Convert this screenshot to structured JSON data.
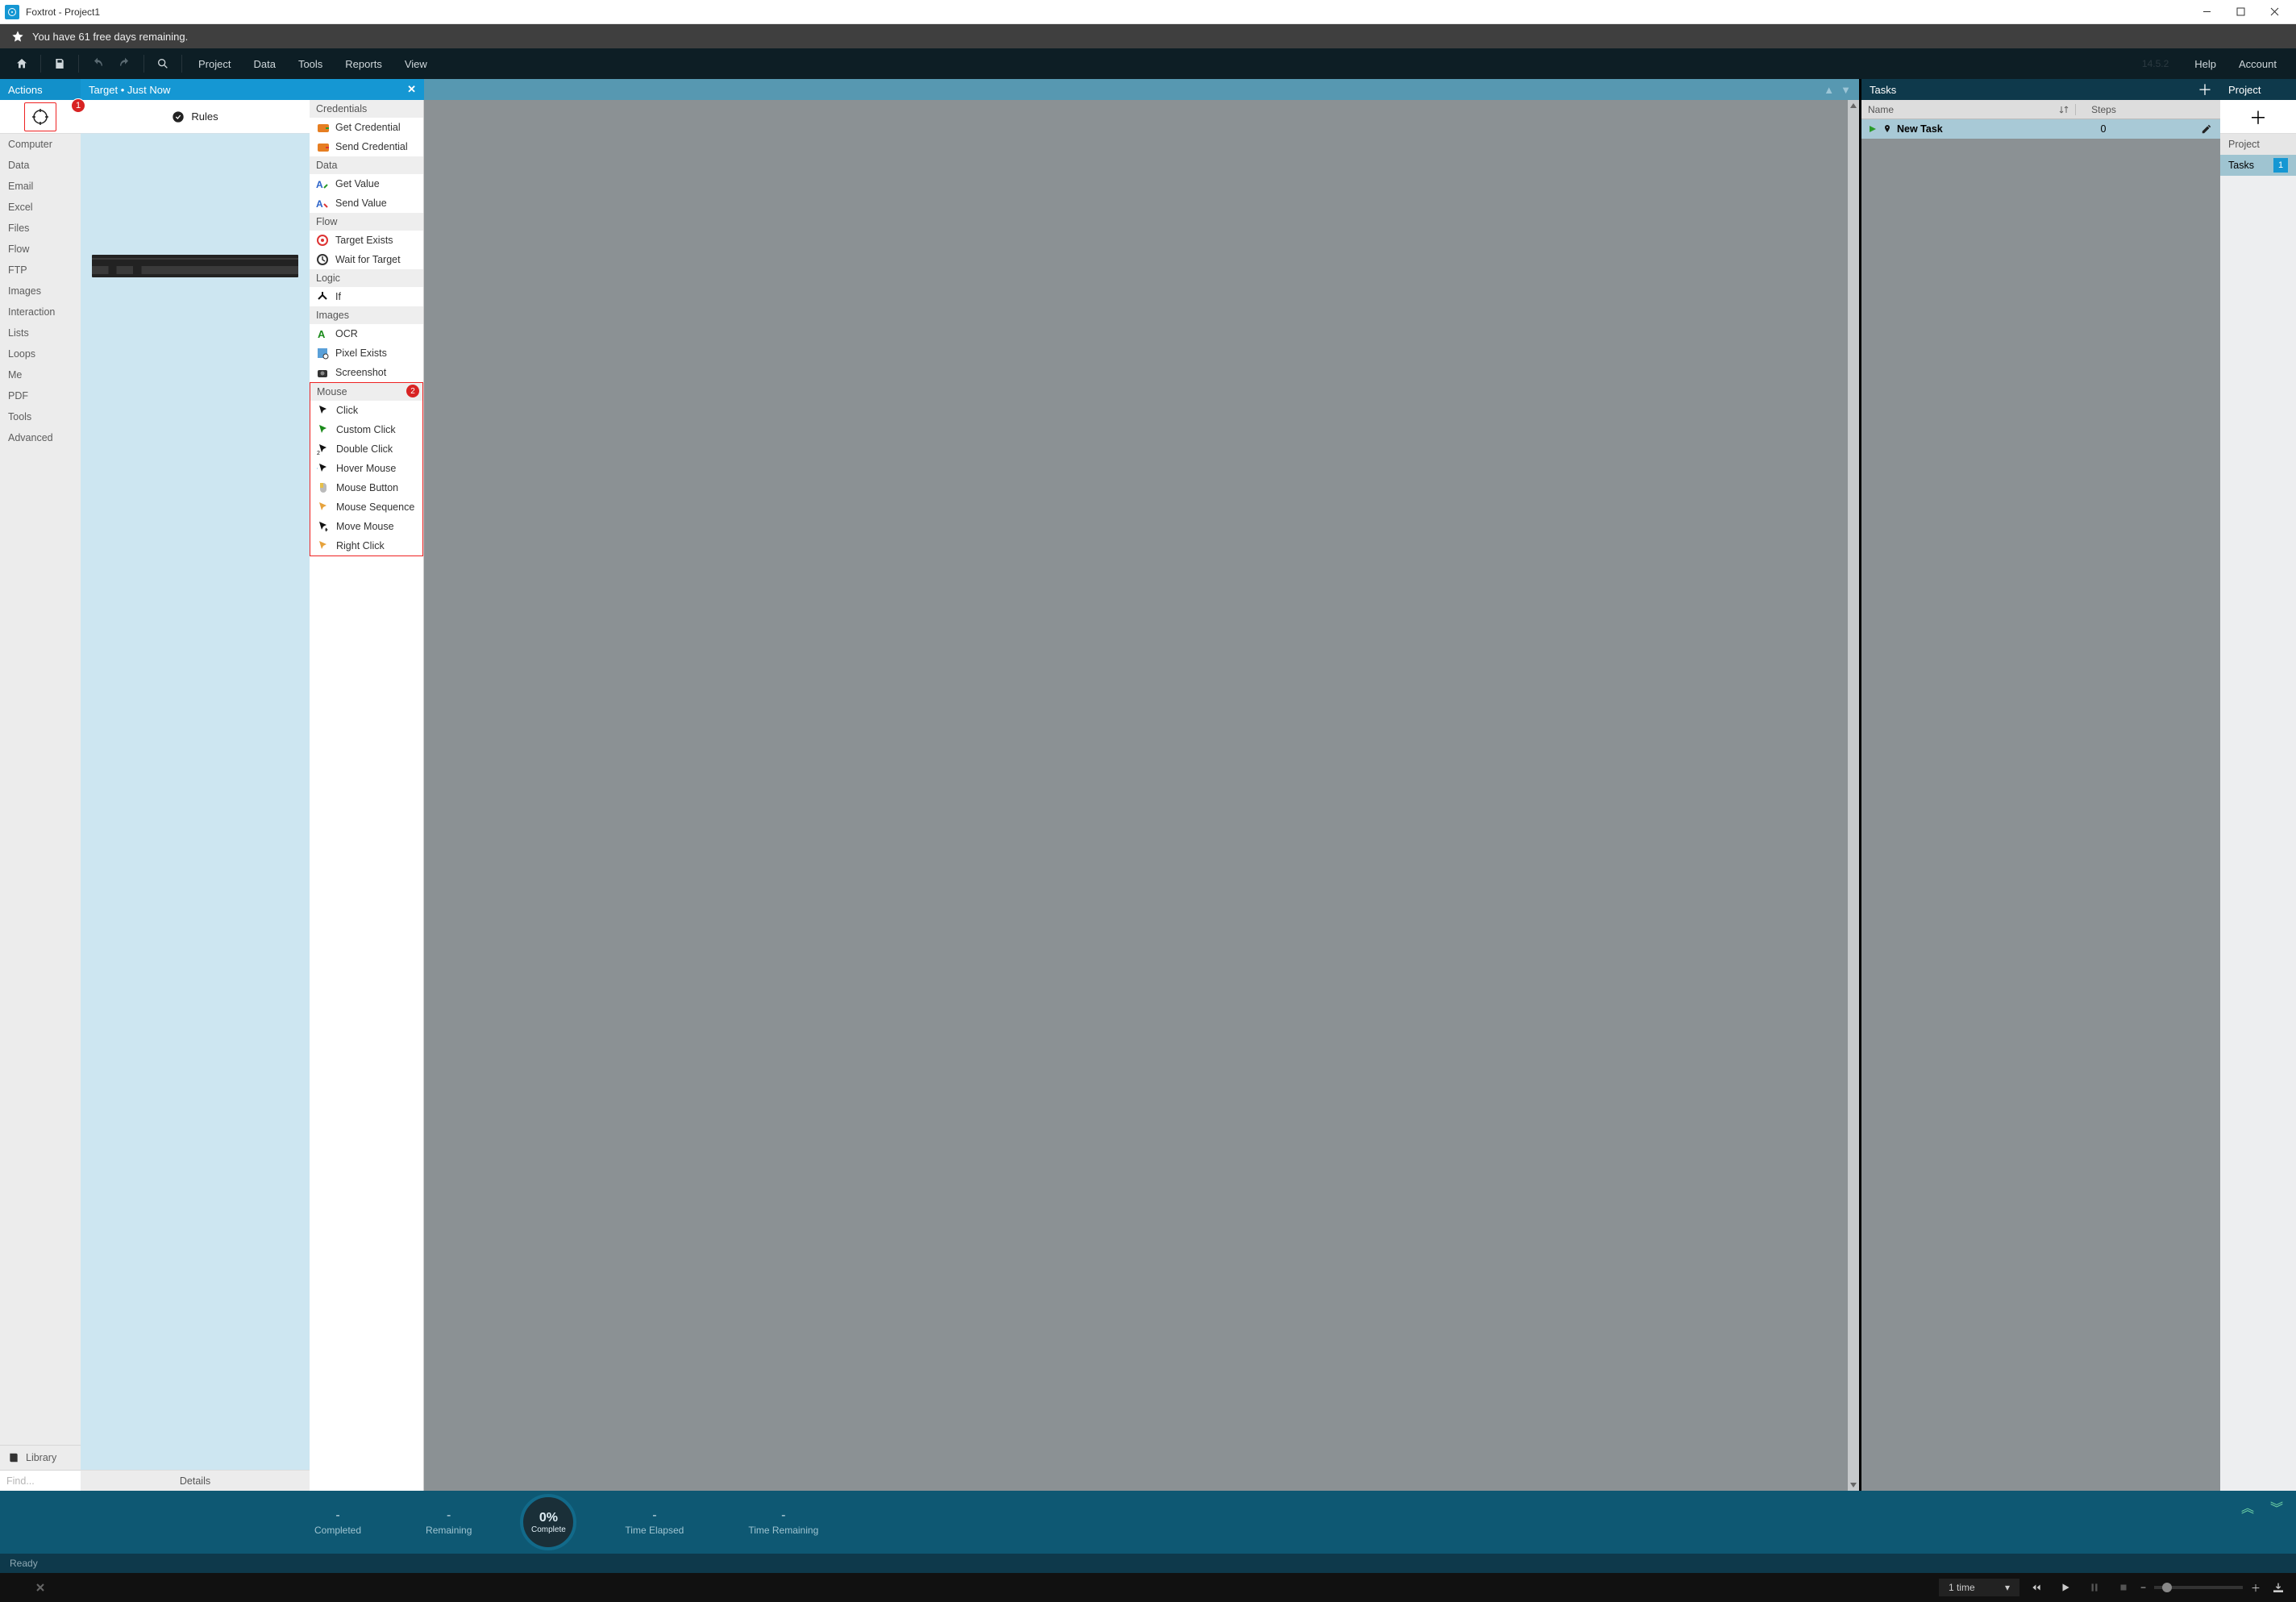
{
  "title": "Foxtrot   -   Project1",
  "banner": "You have 61 free days remaining.",
  "menu": {
    "project": "Project",
    "data": "Data",
    "tools": "Tools",
    "reports": "Reports",
    "view": "View",
    "version": "14.5.2",
    "help": "Help",
    "account": "Account"
  },
  "panelTitles": {
    "actions": "Actions",
    "target": "Target   •   Just Now",
    "tasks": "Tasks",
    "project": "Project"
  },
  "annotations": {
    "one": "1",
    "two": "2"
  },
  "rail": {
    "items": [
      "Computer",
      "Data",
      "Email",
      "Excel",
      "Files",
      "Flow",
      "FTP",
      "Images",
      "Interaction",
      "Lists",
      "Loops",
      "Me",
      "PDF",
      "Tools",
      "Advanced"
    ],
    "library": "Library",
    "find": "Find..."
  },
  "targetPanel": {
    "rules": "Rules",
    "details": "Details"
  },
  "actionGroups": {
    "credentials": {
      "title": "Credentials",
      "items": [
        "Get Credential",
        "Send Credential"
      ]
    },
    "data": {
      "title": "Data",
      "items": [
        "Get Value",
        "Send Value"
      ]
    },
    "flow": {
      "title": "Flow",
      "items": [
        "Target Exists",
        "Wait for Target"
      ]
    },
    "logic": {
      "title": "Logic",
      "items": [
        "If"
      ]
    },
    "images": {
      "title": "Images",
      "items": [
        "OCR",
        "Pixel Exists",
        "Screenshot"
      ]
    },
    "mouse": {
      "title": "Mouse",
      "items": [
        "Click",
        "Custom Click",
        "Double Click",
        "Hover Mouse",
        "Mouse Button",
        "Mouse Sequence",
        "Move Mouse",
        "Right Click"
      ]
    }
  },
  "tasks": {
    "headers": {
      "name": "Name",
      "steps": "Steps"
    },
    "row": {
      "name": "New Task",
      "steps": "0"
    }
  },
  "projectPanel": {
    "header": "Project",
    "tasks": "Tasks",
    "count": "1"
  },
  "progress": {
    "completed": {
      "val": "-",
      "label": "Completed"
    },
    "remaining": {
      "val": "-",
      "label": "Remaining"
    },
    "gauge": {
      "pct": "0%",
      "label": "Complete"
    },
    "elapsed": {
      "val": "-",
      "label": "Time Elapsed"
    },
    "timeRemaining": {
      "val": "-",
      "label": "Time Remaining"
    }
  },
  "status": "Ready",
  "player": {
    "times": "1 time"
  }
}
